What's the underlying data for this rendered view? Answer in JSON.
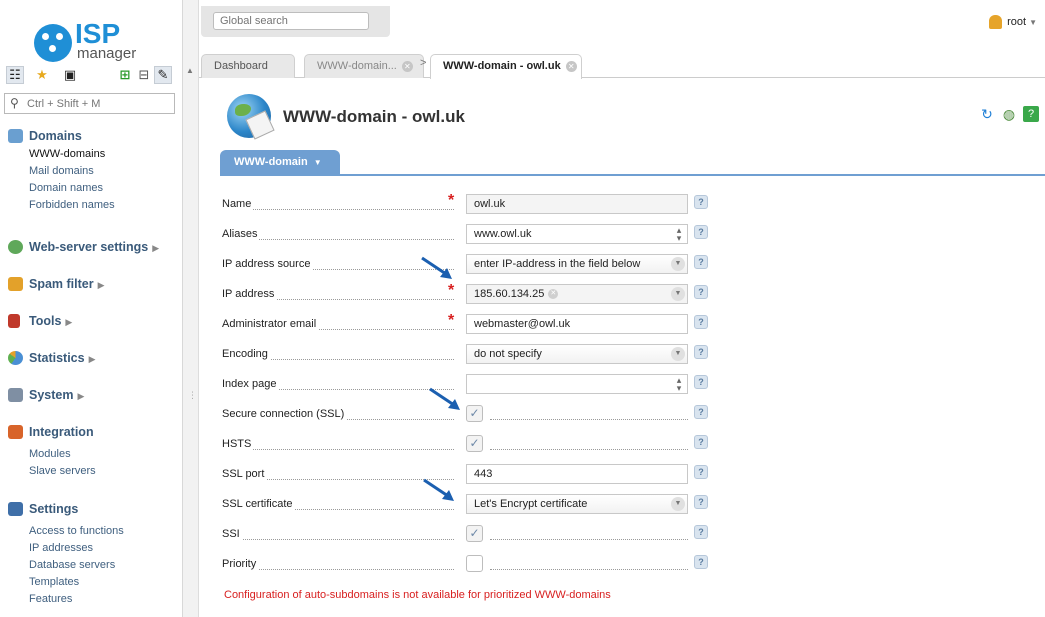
{
  "app": {
    "logo_isp": "ISP",
    "logo_manager": "manager"
  },
  "sidebar": {
    "search_placeholder": "Ctrl + Shift + M",
    "groups": [
      {
        "label": "Domains",
        "items": [
          "WWW-domains",
          "Mail domains",
          "Domain names",
          "Forbidden names"
        ],
        "active": "WWW-domains"
      },
      {
        "label": "Web-server settings",
        "items": []
      },
      {
        "label": "Spam filter",
        "items": []
      },
      {
        "label": "Tools",
        "items": []
      },
      {
        "label": "Statistics",
        "items": []
      },
      {
        "label": "System",
        "items": []
      },
      {
        "label": "Integration",
        "items": [
          "Modules",
          "Slave servers"
        ]
      },
      {
        "label": "Settings",
        "items": [
          "Access to functions",
          "IP addresses",
          "Database servers",
          "Templates",
          "Features"
        ]
      }
    ]
  },
  "topbar": {
    "search_placeholder": "Global search",
    "user": "root"
  },
  "tabs": {
    "dashboard": "Dashboard",
    "tab2": "WWW-domain...",
    "tab3": "WWW-domain - owl.uk"
  },
  "page": {
    "title": "WWW-domain - owl.uk",
    "form_tab": "WWW-domain"
  },
  "form": {
    "name": {
      "label": "Name",
      "value": "owl.uk"
    },
    "aliases": {
      "label": "Aliases",
      "value": "www.owl.uk"
    },
    "ip_source": {
      "label": "IP address source",
      "value": "enter IP-address in the field below"
    },
    "ip_address": {
      "label": "IP address",
      "value": "185.60.134.25"
    },
    "admin_email": {
      "label": "Administrator email",
      "value": "webmaster@owl.uk"
    },
    "encoding": {
      "label": "Encoding",
      "value": "do not specify"
    },
    "index_page": {
      "label": "Index page",
      "value": ""
    },
    "ssl": {
      "label": "Secure connection (SSL)",
      "checked": true
    },
    "hsts": {
      "label": "HSTS",
      "checked": true
    },
    "ssl_port": {
      "label": "SSL port",
      "value": "443"
    },
    "ssl_cert": {
      "label": "SSL certificate",
      "value": "Let's Encrypt certificate"
    },
    "ssi": {
      "label": "SSI",
      "checked": true
    },
    "priority": {
      "label": "Priority",
      "checked": false
    },
    "help_glyph": "?",
    "required_glyph": "*",
    "check_glyph": "✓"
  },
  "warning": "Configuration of auto-subdomains is not available for prioritized WWW-domains",
  "colors": {
    "accent": "#6f9fd2",
    "brand": "#1f8fd6",
    "error": "#d82020",
    "arrow": "#1b5fb0"
  }
}
